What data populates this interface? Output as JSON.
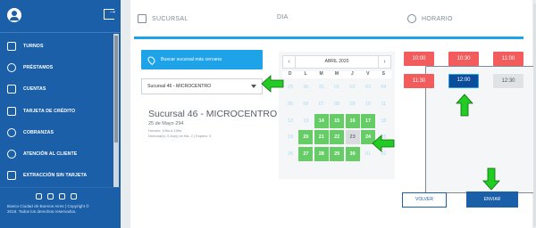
{
  "sidebar": {
    "items": [
      {
        "label": "TURNOS",
        "icon": "number-list-icon"
      },
      {
        "label": "PRÉSTAMOS",
        "icon": "money-bag-icon"
      },
      {
        "label": "CUENTAS",
        "icon": "wallet-icon"
      },
      {
        "label": "TARJETA DE CRÉDITO",
        "icon": "credit-card-icon"
      },
      {
        "label": "COBRANZAS",
        "icon": "hand-coin-icon"
      },
      {
        "label": "ATENCIÓN AL CLIENTE",
        "icon": "headset-icon"
      },
      {
        "label": "EXTRACCIÓN SIN TARJETA",
        "icon": "atm-icon"
      }
    ],
    "copyright_line1": "Banco Ciudad de Buenos Aires | Copyright ©",
    "copyright_line2": "2018. Todos los derechos reservados."
  },
  "steps": {
    "sucursal": "SUCURSAL",
    "dia": "DIA",
    "horario": "HORARIO"
  },
  "branch": {
    "search_label": "Buscar sucursal más cercana",
    "selected": "Sucursal 46 - MICROCENTRO",
    "title": "Sucursal 46 - MICROCENTRO",
    "address": "25 de Mayo 294",
    "hours": "Horario: 10hs a 15hs",
    "queue": "Demora(s): 5 Ac(s) en fila: 2 | Espera: 3"
  },
  "calendar": {
    "month": "ABRIL 2020",
    "prev": "‹",
    "next": "›",
    "weekdays": [
      "D",
      "L",
      "M",
      "M",
      "J",
      "V",
      "S"
    ],
    "weeks": [
      [
        "29",
        "30",
        "31",
        "01",
        "02",
        "03",
        "04"
      ],
      [
        "05",
        "06",
        "07",
        "08",
        "09",
        "10",
        "11"
      ],
      [
        "12",
        "13",
        "14",
        "15",
        "16",
        "17",
        "18"
      ],
      [
        "19",
        "20",
        "21",
        "22",
        "23",
        "24",
        "25"
      ],
      [
        "26",
        "27",
        "28",
        "29",
        "30",
        "01",
        "02"
      ]
    ],
    "available": [
      "14",
      "15",
      "16",
      "17",
      "20",
      "21",
      "22",
      "24",
      "27",
      "28",
      "29",
      "30"
    ],
    "selected_day": "23"
  },
  "times": [
    {
      "label": "10:00",
      "state": "unavailable"
    },
    {
      "label": "10:30",
      "state": "unavailable"
    },
    {
      "label": "11:00",
      "state": "unavailable"
    },
    {
      "label": "11:30",
      "state": "unavailable"
    },
    {
      "label": "12:00",
      "state": "selected"
    },
    {
      "label": "12:30",
      "state": "disabled"
    }
  ],
  "actions": {
    "volver": "VOLVER",
    "enviar": "ENVIAR"
  },
  "colors": {
    "sidebar": "#1a5fa8",
    "accent": "#1fa3e8",
    "available_day": "#66cc66",
    "unavailable_time": "#f25c5c",
    "selected_time": "#0b4d9a",
    "arrow": "#22cc22"
  }
}
